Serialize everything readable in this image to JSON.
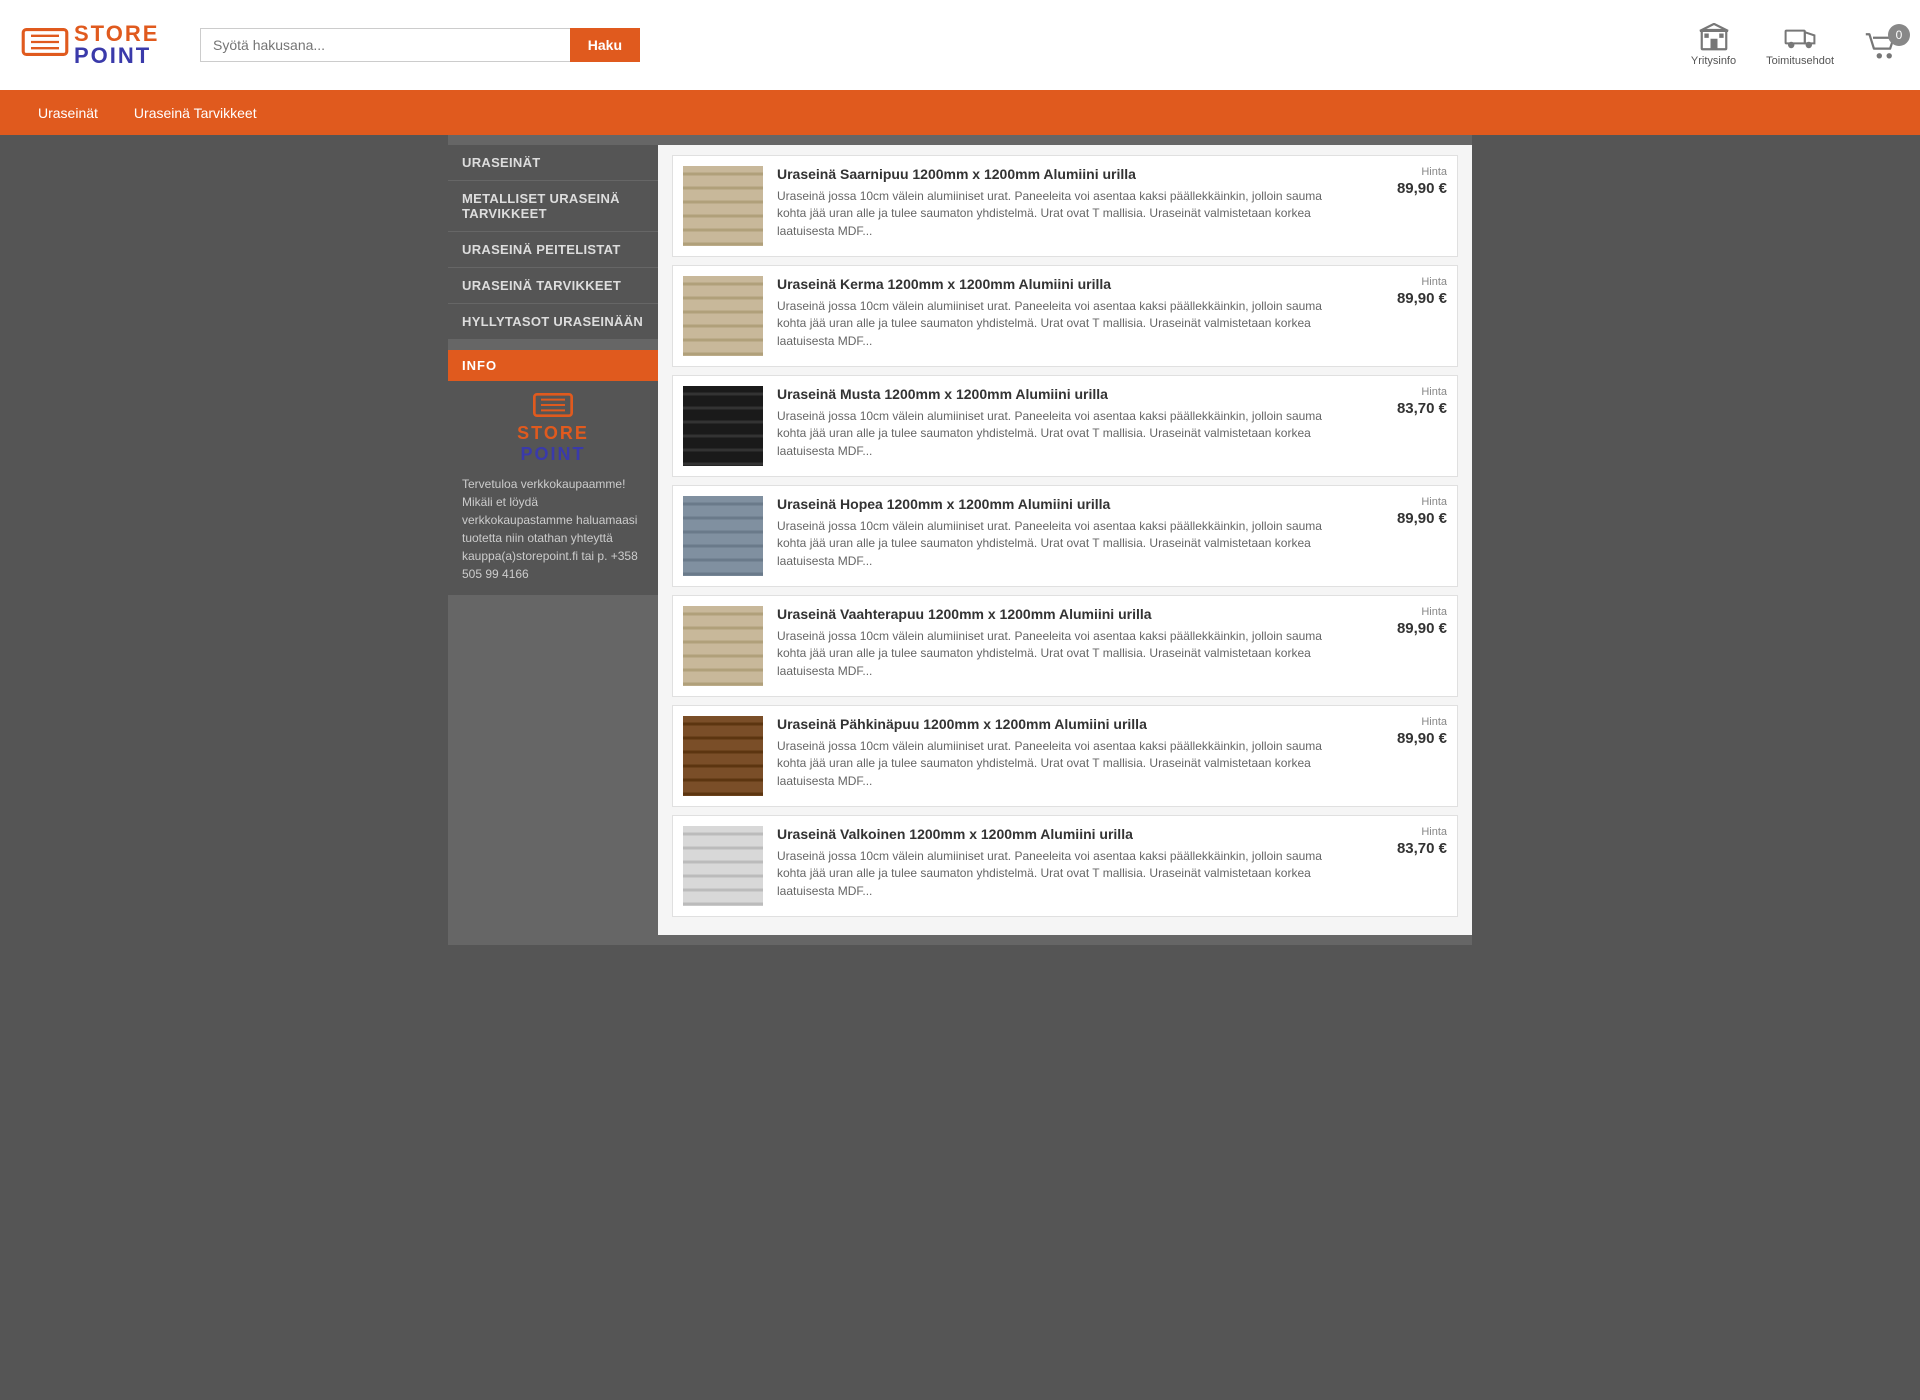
{
  "header": {
    "logo_store": "STORE",
    "logo_point": "POINT",
    "search_placeholder": "Syötä hakusana...",
    "search_button": "Haku",
    "yritysinfo_label": "Yritysinfo",
    "toimitustiedot_label": "Toimitusehdot",
    "cart_count": "0"
  },
  "navbar": {
    "items": [
      {
        "label": "Uraseinät"
      },
      {
        "label": "Uraseinä Tarvikkeet"
      }
    ]
  },
  "sidebar": {
    "menu_items": [
      {
        "label": "URASEINÄT"
      },
      {
        "label": "METALLISET URASEINÄ TARVIKKEET"
      },
      {
        "label": "URASEINÄ PEITELISTAT"
      },
      {
        "label": "URASEINÄ TARVIKKEET"
      },
      {
        "label": "HYLLYTASOT URASEINÄÄN"
      }
    ],
    "info_header": "INFO",
    "info_logo_store": "STORE",
    "info_logo_point": "POINT",
    "info_text": "Tervetuloa verkkokaupaamme! Mikäli et löydä verkkokaupastamme haluamaasi tuotetta niin otathan yhteyttä kauppa(a)storepoint.fi tai p. +358 505 99 4166"
  },
  "products": [
    {
      "id": 1,
      "title": "Uraseinä Saarnipuu 1200mm x 1200mm Alumiini urilla",
      "desc": "Uraseinä jossa 10cm välein alumiiniset urat. Paneeleita voi asentaa kaksi päällekkäinkin, jolloin sauma kohta jää uran alle ja tulee saumaton yhdistelmä. Urat ovat T mallisia.  Uraseinät valmistetaan korkea laatuisesta MDF...",
      "price_label": "Hinta",
      "price": "89,90 €",
      "thumb_class": "light-beige"
    },
    {
      "id": 2,
      "title": "Uraseinä Kerma 1200mm x 1200mm Alumiini urilla",
      "desc": "Uraseinä jossa 10cm välein alumiiniset urat. Paneeleita voi asentaa kaksi päällekkäinkin, jolloin sauma kohta jää uran alle ja tulee saumaton yhdistelmä. Urat ovat T mallisia.  Uraseinät valmistetaan korkea laatuisesta MDF...",
      "price_label": "Hinta",
      "price": "89,90 €",
      "thumb_class": "light-beige"
    },
    {
      "id": 3,
      "title": "Uraseinä Musta 1200mm x 1200mm Alumiini urilla",
      "desc": "Uraseinä jossa 10cm välein alumiiniset urat. Paneeleita voi asentaa kaksi päällekkäinkin, jolloin sauma kohta jää uran alle ja tulee saumaton yhdistelmä. Urat ovat T mallisia. Uraseinät valmistetaan korkea laatuisesta MDF...",
      "price_label": "Hinta",
      "price": "83,70 €",
      "thumb_class": "dark"
    },
    {
      "id": 4,
      "title": "Uraseinä Hopea 1200mm x 1200mm Alumiini urilla",
      "desc": "Uraseinä jossa 10cm välein alumiiniset urat. Paneeleita voi asentaa kaksi päällekkäinkin, jolloin sauma kohta jää uran alle ja tulee saumaton yhdistelmä. Urat ovat T mallisia.  Uraseinät valmistetaan korkea laatuisesta MDF...",
      "price_label": "Hinta",
      "price": "89,90 €",
      "thumb_class": "silver"
    },
    {
      "id": 5,
      "title": "Uraseinä Vaahterapuu 1200mm x 1200mm Alumiini urilla",
      "desc": "Uraseinä jossa 10cm välein alumiiniset urat. Paneeleita voi asentaa kaksi päällekkäinkin, jolloin sauma kohta jää uran alle ja tulee saumaton yhdistelmä. Urat ovat T mallisia.  Uraseinät valmistetaan korkea laatuisesta MDF...",
      "price_label": "Hinta",
      "price": "89,90 €",
      "thumb_class": "light-beige"
    },
    {
      "id": 6,
      "title": "Uraseinä Pähkinäpuu 1200mm x 1200mm Alumiini urilla",
      "desc": "Uraseinä jossa 10cm välein alumiiniset urat. Paneeleita voi asentaa kaksi päällekkäinkin, jolloin sauma kohta jää uran alle ja tulee saumaton yhdistelmä. Urat ovat T mallisia. Uraseinät valmistetaan korkea laatuisesta MDF...",
      "price_label": "Hinta",
      "price": "89,90 €",
      "thumb_class": "walnut"
    },
    {
      "id": 7,
      "title": "Uraseinä Valkoinen 1200mm x 1200mm Alumiini urilla",
      "desc": "Uraseinä jossa 10cm välein alumiiniset urat. Paneeleita voi asentaa kaksi päällekkäinkin, jolloin sauma kohta jää uran alle ja tulee saumaton yhdistelmä. Urat ovat T mallisia. Uraseinät valmistetaan korkea laatuisesta MDF...",
      "price_label": "Hinta",
      "price": "83,70 €",
      "thumb_class": "white"
    }
  ]
}
